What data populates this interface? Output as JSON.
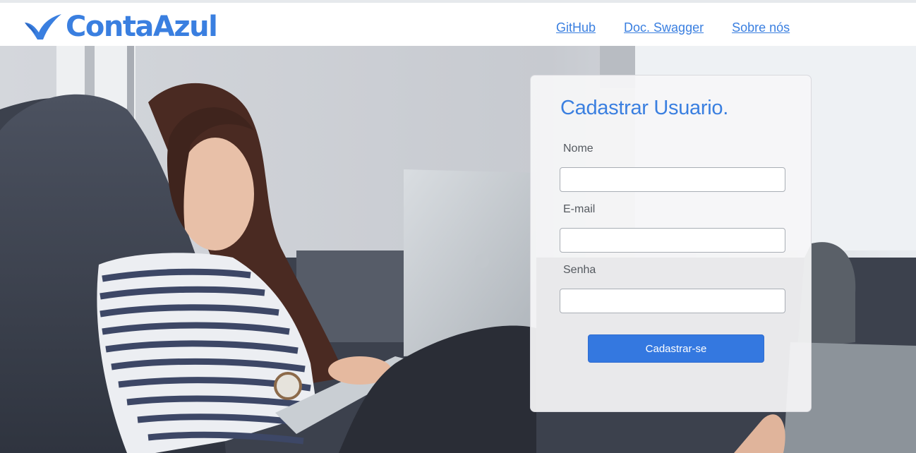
{
  "header": {
    "brand": "ContaAzul",
    "brand_color": "#3a7fe0",
    "nav": [
      {
        "label": "GitHub"
      },
      {
        "label": "Doc. Swagger"
      },
      {
        "label": "Sobre nós"
      }
    ]
  },
  "hero": {
    "image": "woman-on-sofa-with-laptop"
  },
  "form": {
    "title": "Cadastrar Usuario.",
    "fields": [
      {
        "label": "Nome",
        "value": ""
      },
      {
        "label": "E-mail",
        "value": ""
      },
      {
        "label": "Senha",
        "value": ""
      }
    ],
    "submit_label": "Cadastrar-se",
    "accent_color": "#3478e0"
  }
}
